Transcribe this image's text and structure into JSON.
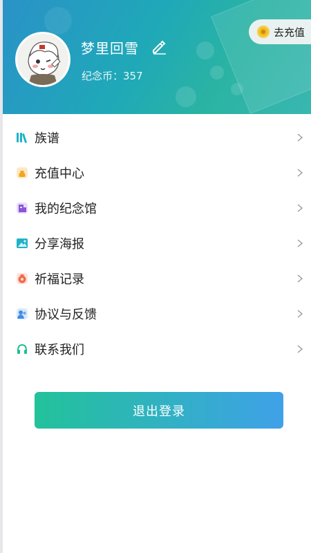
{
  "profile": {
    "username": "梦里回雪",
    "coins_label": "纪念币：357"
  },
  "header": {
    "recharge_label": "去充值"
  },
  "menu": {
    "items": [
      {
        "label": "族谱",
        "icon": "books-icon",
        "color": "#1fb3c8"
      },
      {
        "label": "充值中心",
        "icon": "money-bag-icon",
        "color": "#f4a41f"
      },
      {
        "label": "我的纪念馆",
        "icon": "memorial-hall-icon",
        "color": "#8a55d8"
      },
      {
        "label": "分享海报",
        "icon": "image-icon",
        "color": "#1fb3c8"
      },
      {
        "label": "祈福记录",
        "icon": "prayer-record-icon",
        "color": "#f06b4b"
      },
      {
        "label": "协议与反馈",
        "icon": "users-icon",
        "color": "#3c8ee8"
      },
      {
        "label": "联系我们",
        "icon": "headset-icon",
        "color": "#1fbf8f"
      }
    ]
  },
  "logout": {
    "label": "退出登录"
  },
  "colors": {
    "header_start": "#2a92c8",
    "header_end": "#39b7b0",
    "button_start": "#22c29a",
    "button_end": "#3fa1e8"
  }
}
